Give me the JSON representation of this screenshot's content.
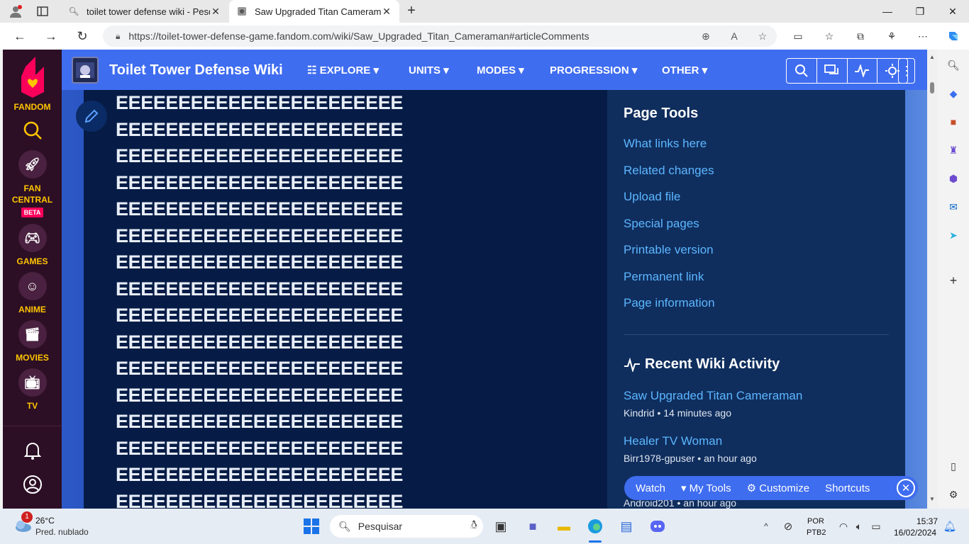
{
  "browser": {
    "tabs": [
      {
        "title": "toilet tower defense wiki - Pesqu"
      },
      {
        "title": "Saw Upgraded Titan Cameraman"
      }
    ],
    "url": "https://toilet-tower-defense-game.fandom.com/wiki/Saw_Upgraded_Titan_Cameraman#articleComments"
  },
  "fandom_rail": {
    "brand": "FANDOM",
    "items": [
      {
        "label": "FAN CENTRAL",
        "badge": "BETA"
      },
      {
        "label": "GAMES"
      },
      {
        "label": "ANIME"
      },
      {
        "label": "MOVIES"
      },
      {
        "label": "TV"
      }
    ]
  },
  "wiki": {
    "title": "Toilet Tower Defense Wiki",
    "menu": [
      "EXPLORE",
      "UNITS",
      "MODES",
      "PROGRESSION",
      "OTHER"
    ]
  },
  "content": {
    "line_text": "EEEEEEEEEEEEEEEEEEEEEEE",
    "lines": 16
  },
  "sidebar": {
    "page_tools_heading": "Page Tools",
    "page_tools": [
      "What links here",
      "Related changes",
      "Upload file",
      "Special pages",
      "Printable version",
      "Permanent link",
      "Page information"
    ],
    "activity_heading": "Recent Wiki Activity",
    "activity": [
      {
        "title": "Saw Upgraded Titan Cameraman",
        "meta": "Kindrid • 14 minutes ago"
      },
      {
        "title": "Healer TV Woman",
        "meta": "Birr1978-gpuser • an hour ago"
      },
      {
        "meta": "Android201 • an hour ago"
      }
    ]
  },
  "toolbar": {
    "watch": "Watch",
    "my_tools": "My Tools",
    "customize": "Customize",
    "shortcuts": "Shortcuts"
  },
  "taskbar": {
    "weather_temp": "26°C",
    "weather_desc": "Pred. nublado",
    "weather_badge": "1",
    "search_placeholder": "Pesquisar",
    "lang_top": "POR",
    "lang_bottom": "PTB2",
    "time": "15:37",
    "date": "16/02/2024"
  }
}
